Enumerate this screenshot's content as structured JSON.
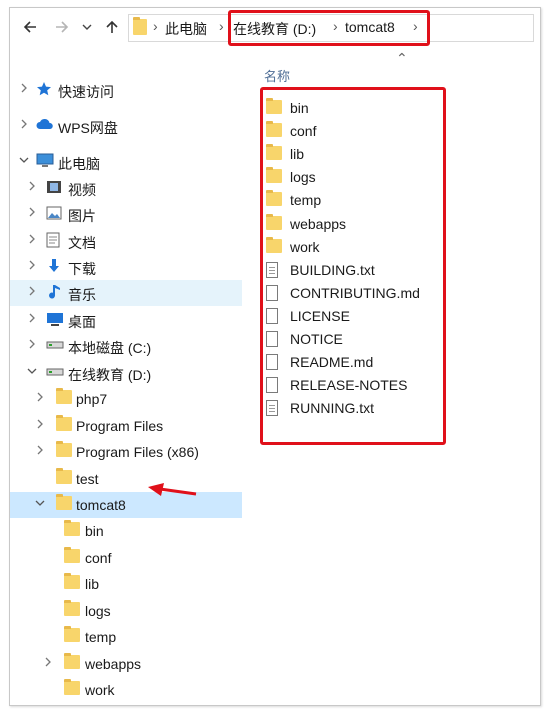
{
  "colors": {
    "accent_red": "#e0101a",
    "selection": "#cce8ff",
    "hover": "#e5f3fb",
    "folder": "#f8d56b",
    "header_text": "#4f6e96"
  },
  "toolbar": {
    "back_icon": "arrow-left-icon",
    "forward_icon": "arrow-right-icon",
    "recent_icon": "chevron-down-icon",
    "up_icon": "arrow-up-icon"
  },
  "address": {
    "crumbs": [
      "此电脑",
      "在线教育 (D:)",
      "tomcat8"
    ]
  },
  "content": {
    "column_header": "名称",
    "items": [
      {
        "name": "bin",
        "kind": "folder"
      },
      {
        "name": "conf",
        "kind": "folder"
      },
      {
        "name": "lib",
        "kind": "folder"
      },
      {
        "name": "logs",
        "kind": "folder"
      },
      {
        "name": "temp",
        "kind": "folder"
      },
      {
        "name": "webapps",
        "kind": "folder"
      },
      {
        "name": "work",
        "kind": "folder"
      },
      {
        "name": "BUILDING.txt",
        "kind": "text"
      },
      {
        "name": "CONTRIBUTING.md",
        "kind": "file"
      },
      {
        "name": "LICENSE",
        "kind": "file"
      },
      {
        "name": "NOTICE",
        "kind": "file"
      },
      {
        "name": "README.md",
        "kind": "file"
      },
      {
        "name": "RELEASE-NOTES",
        "kind": "file"
      },
      {
        "name": "RUNNING.txt",
        "kind": "text"
      }
    ]
  },
  "nav": {
    "items": [
      {
        "label": "快速访问",
        "icon": "star-icon",
        "expander": "collapsed"
      },
      {
        "label": "WPS网盘",
        "icon": "cloud-icon",
        "expander": "collapsed"
      },
      {
        "label": "此电脑",
        "icon": "computer-icon",
        "expander": "expanded"
      },
      {
        "label": "视频",
        "icon": "video-icon",
        "expander": "collapsed"
      },
      {
        "label": "图片",
        "icon": "pictures-icon",
        "expander": "collapsed"
      },
      {
        "label": "文档",
        "icon": "documents-icon",
        "expander": "collapsed"
      },
      {
        "label": "下载",
        "icon": "download-icon",
        "expander": "collapsed"
      },
      {
        "label": "音乐",
        "icon": "music-icon",
        "expander": "collapsed",
        "state": "hover"
      },
      {
        "label": "桌面",
        "icon": "desktop-icon",
        "expander": "collapsed"
      },
      {
        "label": "本地磁盘 (C:)",
        "icon": "drive-icon",
        "expander": "collapsed"
      },
      {
        "label": "在线教育 (D:)",
        "icon": "drive-icon",
        "expander": "expanded"
      },
      {
        "label": "php7",
        "icon": "folder-icon",
        "expander": "collapsed"
      },
      {
        "label": "Program Files",
        "icon": "folder-icon",
        "expander": "collapsed"
      },
      {
        "label": "Program Files (x86)",
        "icon": "folder-icon",
        "expander": "collapsed"
      },
      {
        "label": "test",
        "icon": "folder-icon",
        "expander": "none"
      },
      {
        "label": "tomcat8",
        "icon": "folder-icon",
        "expander": "expanded",
        "state": "selected"
      },
      {
        "label": "bin",
        "icon": "folder-icon",
        "expander": "none"
      },
      {
        "label": "conf",
        "icon": "folder-icon",
        "expander": "none"
      },
      {
        "label": "lib",
        "icon": "folder-icon",
        "expander": "none"
      },
      {
        "label": "logs",
        "icon": "folder-icon",
        "expander": "none"
      },
      {
        "label": "temp",
        "icon": "folder-icon",
        "expander": "none"
      },
      {
        "label": "webapps",
        "icon": "folder-icon",
        "expander": "collapsed"
      },
      {
        "label": "work",
        "icon": "folder-icon",
        "expander": "none"
      }
    ]
  }
}
